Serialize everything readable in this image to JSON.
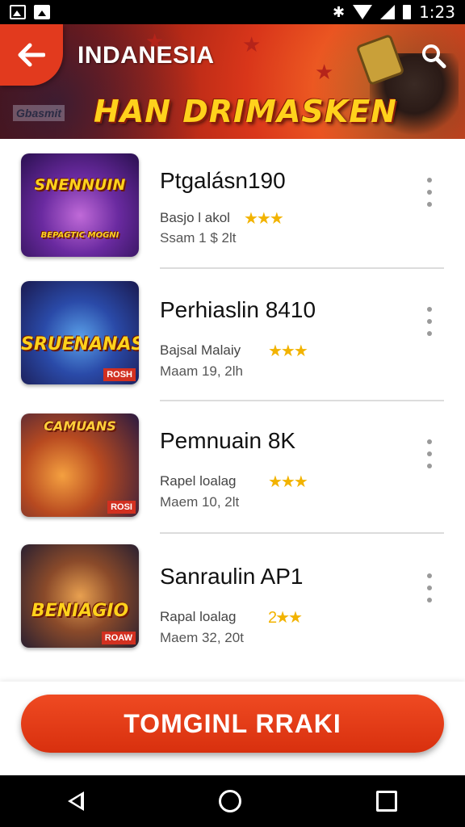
{
  "status_bar": {
    "time": "1:23",
    "icons": [
      "image-icon",
      "photo-icon",
      "bluetooth-icon",
      "wifi-icon",
      "signal-icon",
      "battery-icon"
    ]
  },
  "header": {
    "title": "INDANESIA",
    "banner_text": "HAN DRIMASKEN",
    "banner_logo": "Gbasmit",
    "back_icon": "arrow-left-icon",
    "search_icon": "search-icon",
    "accent_color": "#e23a1e"
  },
  "games": [
    {
      "title": "Ptgalásn190",
      "meta1": "Basjo l akol",
      "meta2": "Ssam 1 $ 2lt",
      "stars": "★★★",
      "thumb_text": "SNENNUIN",
      "thumb_sub": "BEPAGTIC MOGNI"
    },
    {
      "title": "Perhiaslin 8410",
      "meta1": "Bajsal Malaiy",
      "meta2": "Maam 19, 2lh",
      "stars": "★★★",
      "thumb_text": "SRUENANAS",
      "thumb_tag": "ROSH"
    },
    {
      "title": "Pemnuain 8K",
      "meta1": "Rapel loalag",
      "meta2": "Maem 10, 2lt",
      "stars": "★★★",
      "thumb_text": "CAMUANS",
      "thumb_tag": "ROSI"
    },
    {
      "title": "Sanraulin AP1",
      "meta1": "Rapal loalag",
      "meta2": "Maem 32, 20t",
      "stars": "2★★",
      "thumb_text": "BENIAGIO",
      "thumb_tag": "ROAW"
    }
  ],
  "cta": {
    "label": "TOMGINL RRAKI"
  },
  "colors": {
    "primary": "#e23a1e",
    "star": "#f2b300",
    "divider": "#dcdcdc"
  }
}
